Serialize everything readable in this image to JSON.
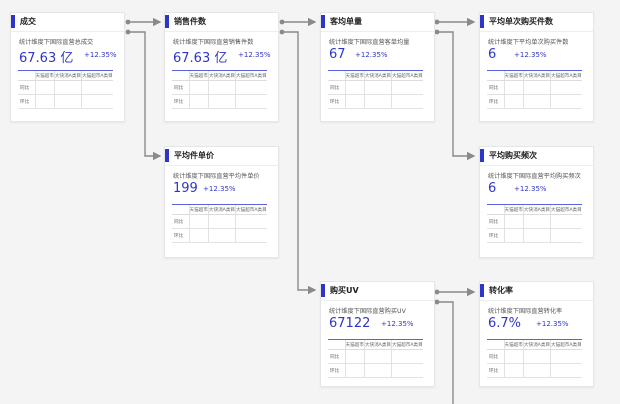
{
  "accent_color": "#2e36c9",
  "connector_color": "#8a8a8a",
  "cards": [
    {
      "title": "成交",
      "subtitle": "统计维度下国际直营总成交",
      "value": "67.63 亿",
      "change": "+12.35%",
      "columns": [
        "",
        "天猫超市",
        "大快消A类目",
        "大猫超市A类目"
      ],
      "rows": [
        "同比",
        "环比"
      ]
    },
    {
      "title": "销售件数",
      "subtitle": "统计维度下国际直营销售件数",
      "value": "67.63 亿",
      "change": "+12.35%",
      "columns": [
        "",
        "天猫超市",
        "大快消A类目",
        "大猫超市A类目"
      ],
      "rows": [
        "同比",
        "环比"
      ]
    },
    {
      "title": "客均单量",
      "subtitle": "统计维度下国际直营客单均量",
      "value": "67",
      "change": "+12.35%",
      "columns": [
        "",
        "天猫超市",
        "大快消A类目",
        "大猫超市A类目"
      ],
      "rows": [
        "同比",
        "环比"
      ]
    },
    {
      "title": "平均单次购买件数",
      "subtitle": "统计维度下平均单次购买件数",
      "value": "6",
      "change": "+12.35%",
      "columns": [
        "",
        "天猫超市",
        "大快消A类目",
        "大猫超市A类目"
      ],
      "rows": [
        "同比",
        "环比"
      ]
    },
    {
      "title": "平均件单价",
      "subtitle": "统计维度下国际直营平均件单价",
      "value": "199",
      "change": "+12.35%",
      "columns": [
        "",
        "天猫超市",
        "大快消A类目",
        "大猫超市A类目"
      ],
      "rows": [
        "同比",
        "环比"
      ]
    },
    {
      "title": "平均购买频次",
      "subtitle": "统计维度下国际直营平均购买频次",
      "value": "6",
      "change": "+12.35%",
      "columns": [
        "",
        "天猫超市",
        "大快消A类目",
        "大猫超市A类目"
      ],
      "rows": [
        "同比",
        "环比"
      ]
    },
    {
      "title": "购买UV",
      "subtitle": "统计维度下国际直营购买UV",
      "value": "67122",
      "change": "+12.35%",
      "columns": [
        "",
        "天猫超市",
        "大快消A类目",
        "大猫超市A类目"
      ],
      "rows": [
        "同比",
        "环比"
      ]
    },
    {
      "title": "转化率",
      "subtitle": "统计维度下国际直营转化率",
      "value": "6.7%",
      "change": "+12.35%",
      "columns": [
        "",
        "天猫超市",
        "大快消A类目",
        "大猫超市A类目"
      ],
      "rows": [
        "同比",
        "环比"
      ]
    }
  ]
}
